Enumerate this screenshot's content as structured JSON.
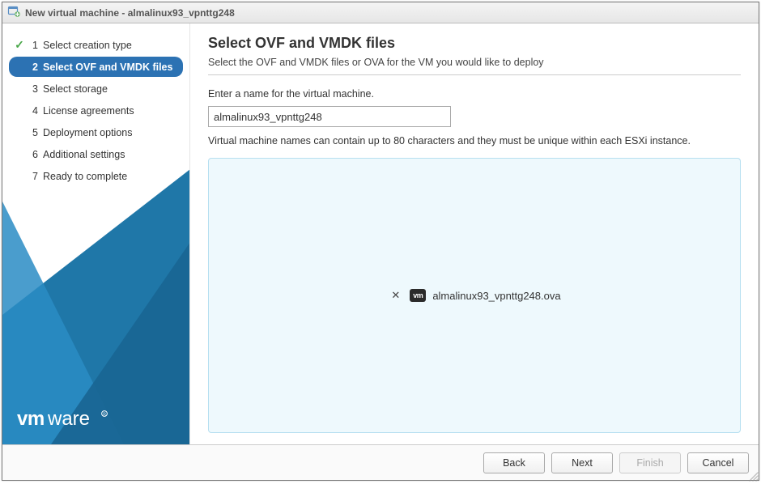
{
  "window": {
    "title": "New virtual machine - almalinux93_vpnttg248"
  },
  "sidebar": {
    "steps": [
      {
        "num": "1",
        "label": "Select creation type",
        "state": "done"
      },
      {
        "num": "2",
        "label": "Select OVF and VMDK files",
        "state": "active"
      },
      {
        "num": "3",
        "label": "Select storage",
        "state": "pending"
      },
      {
        "num": "4",
        "label": "License agreements",
        "state": "pending"
      },
      {
        "num": "5",
        "label": "Deployment options",
        "state": "pending"
      },
      {
        "num": "6",
        "label": "Additional settings",
        "state": "pending"
      },
      {
        "num": "7",
        "label": "Ready to complete",
        "state": "pending"
      }
    ]
  },
  "main": {
    "heading": "Select OVF and VMDK files",
    "subtitle": "Select the OVF and VMDK files or OVA for the VM you would like to deploy",
    "prompt": "Enter a name for the virtual machine.",
    "vm_name_value": "almalinux93_vpnttg248",
    "hint": "Virtual machine names can contain up to 80 characters and they must be unique within each ESXi instance.",
    "file": {
      "name": "almalinux93_vpnttg248.ova",
      "badge_text": "vm"
    }
  },
  "buttons": {
    "back": "Back",
    "next": "Next",
    "finish": "Finish",
    "cancel": "Cancel"
  },
  "colors": {
    "active_nav": "#2c72b3",
    "dropzone_bg": "#eef9fd",
    "dropzone_border": "#b6dff0",
    "check": "#4ba84b"
  }
}
